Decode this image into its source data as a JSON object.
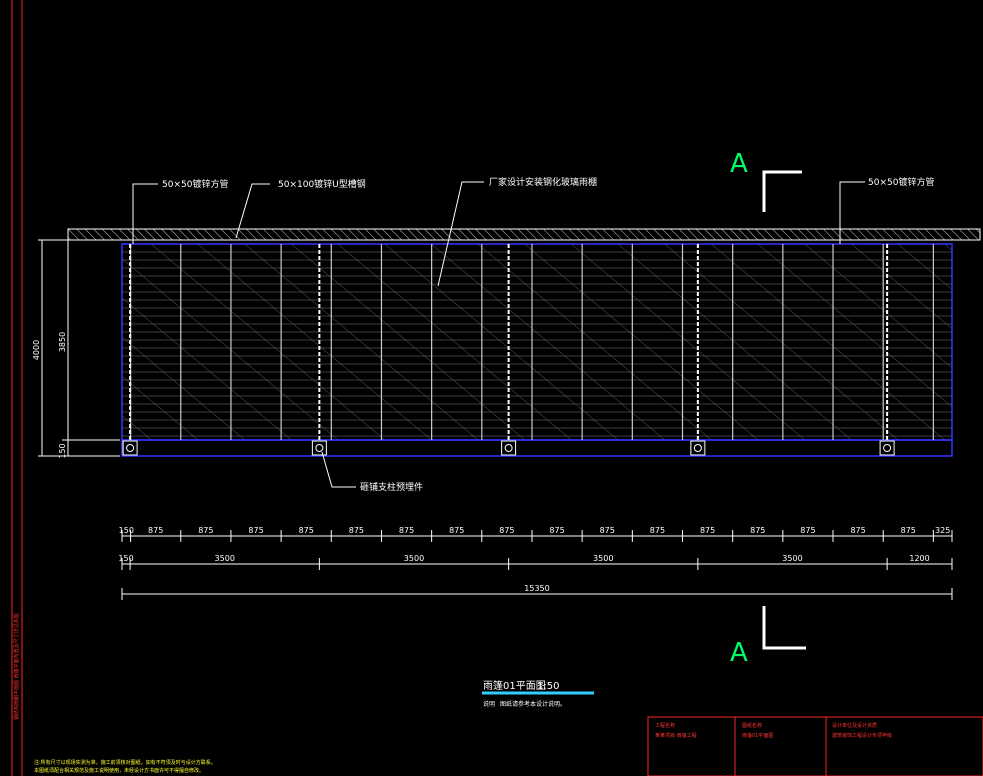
{
  "drawing": {
    "callouts": {
      "tube_left": "50×50镀锌方管",
      "channel": "50×100镀锌U型槽钢",
      "glass": "厂家设计安装钢化玻璃雨棚",
      "tube_right": "50×50镀锌方管",
      "embedded": "砸铺支柱预埋件"
    },
    "section_letter": "A",
    "vertical_dims": {
      "overall": "4000",
      "depth": "3850",
      "edge": "150"
    },
    "dim_row_1": [
      "150",
      "875",
      "875",
      "875",
      "875",
      "875",
      "875",
      "875",
      "875",
      "875",
      "875",
      "875",
      "875",
      "875",
      "875",
      "875",
      "875",
      "325"
    ],
    "dim_row_2": [
      "150",
      "3500",
      "3500",
      "3500",
      "3500",
      "1200"
    ],
    "dim_total": "15350",
    "title": "雨篷01平面图",
    "scale": "1:50",
    "note_title": "说明",
    "note_text": "图纸请参考本设计说明。",
    "left_notes": [
      "注:所有尺寸以现场实测为准，施工前须核对图纸，如有不符须及时与设计方联系。",
      "本图纸须配合相关规范及施工说明使用，未经设计方书面许可不得擅自修改。"
    ],
    "side_note": "钢结构雨棚平面图 雨篷平面布置及尺寸详见本图",
    "titleblock": {
      "cell1_head": "工程名称",
      "cell1_body": "某某项目 雨篷工程",
      "cell2_head": "图纸名称",
      "cell2_body": "雨篷01平面图",
      "cell3_head": "设计单位及设计资质",
      "cell3_body": "建筑装饰工程设计专项甲级"
    }
  }
}
